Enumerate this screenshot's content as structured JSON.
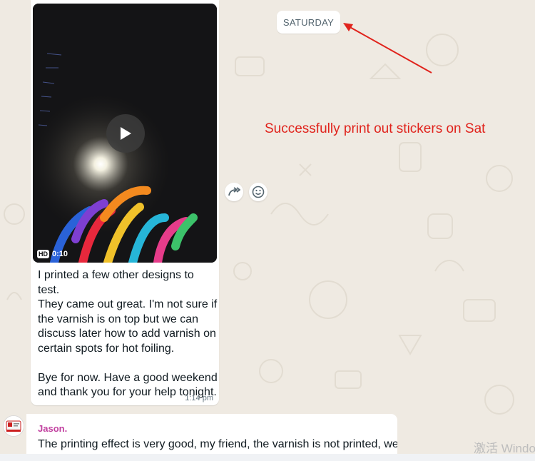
{
  "date_divider": {
    "label": "SATURDAY"
  },
  "annotation": {
    "text": "Successfully print out stickers on Sat",
    "color": "#e0231c"
  },
  "message_1": {
    "video": {
      "hd_badge": "HD",
      "duration": "0:10"
    },
    "text": "I printed a few other designs to test.\nThey came out great. I'm not sure if\nthe varnish is on top but we can\ndiscuss later how to add varnish on\ncertain spots for hot foiling.\n\nBye for now. Have a good weekend\nand thank you for your help tonight.",
    "time": "1:14 pm"
  },
  "message_actions": {
    "forward_icon": "forward-icon",
    "react_icon": "emoji-icon"
  },
  "message_2": {
    "sender": "Jason.",
    "text": "The printing effect is very good, my friend, the varnish is not printed, we"
  },
  "watermark": {
    "text": "激活 Windo"
  },
  "colors": {
    "chat_bg": "#efeae2",
    "bubble": "#ffffff",
    "sender": "#c13f9f",
    "time": "#667781"
  }
}
